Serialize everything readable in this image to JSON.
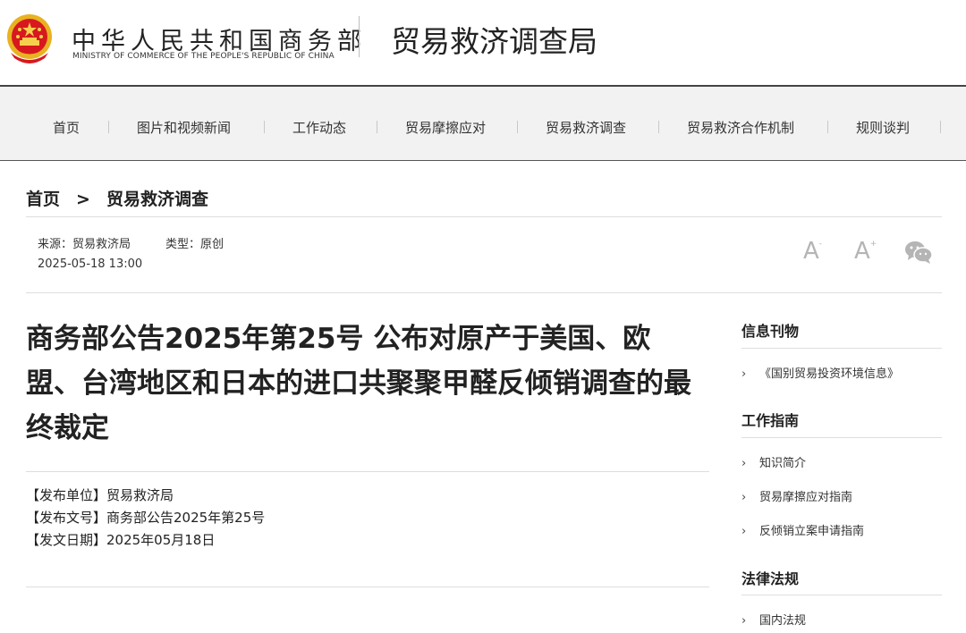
{
  "header": {
    "ministry_cn": "中华人民共和国商务部",
    "ministry_en": "MINISTRY OF COMMERCE OF THE PEOPLE'S REPUBLIC OF CHINA",
    "bureau": "贸易救济调查局"
  },
  "nav": {
    "items": [
      {
        "label": "首页"
      },
      {
        "label": "图片和视频新闻"
      },
      {
        "label": "工作动态"
      },
      {
        "label": "贸易摩擦应对"
      },
      {
        "label": "贸易救济调查"
      },
      {
        "label": "贸易救济合作机制"
      },
      {
        "label": "规则谈判"
      }
    ]
  },
  "breadcrumb": {
    "home": "首页",
    "separator": ">",
    "current": "贸易救济调查"
  },
  "meta": {
    "source": "来源：贸易救济局",
    "type": "类型：原创",
    "datetime": "2025-05-18 13:00",
    "font_large": "A",
    "font_small": "A",
    "plus": "+",
    "minus": "-"
  },
  "article": {
    "title": "商务部公告2025年第25号 公布对原产于美国、欧盟、台湾地区和日本的进口共聚聚甲醛反倾销调查的最终裁定",
    "issuer": "【发布单位】贸易救济局",
    "doc_number": "【发布文号】商务部公告2025年第25号",
    "date": "【发文日期】2025年05月18日"
  },
  "sidebar": {
    "sections": [
      {
        "heading": "信息刊物",
        "items": [
          "《国别贸易投资环境信息》"
        ]
      },
      {
        "heading": "工作指南",
        "items": [
          "知识简介",
          "贸易摩擦应对指南",
          "反倾销立案申请指南"
        ]
      },
      {
        "heading": "法律法规",
        "items": [
          "国内法规"
        ]
      }
    ],
    "chevron": "›"
  },
  "colors": {
    "emblem_red": "#d7181f",
    "emblem_gold": "#e8b321",
    "nav_bg": "#f2f2f2"
  }
}
